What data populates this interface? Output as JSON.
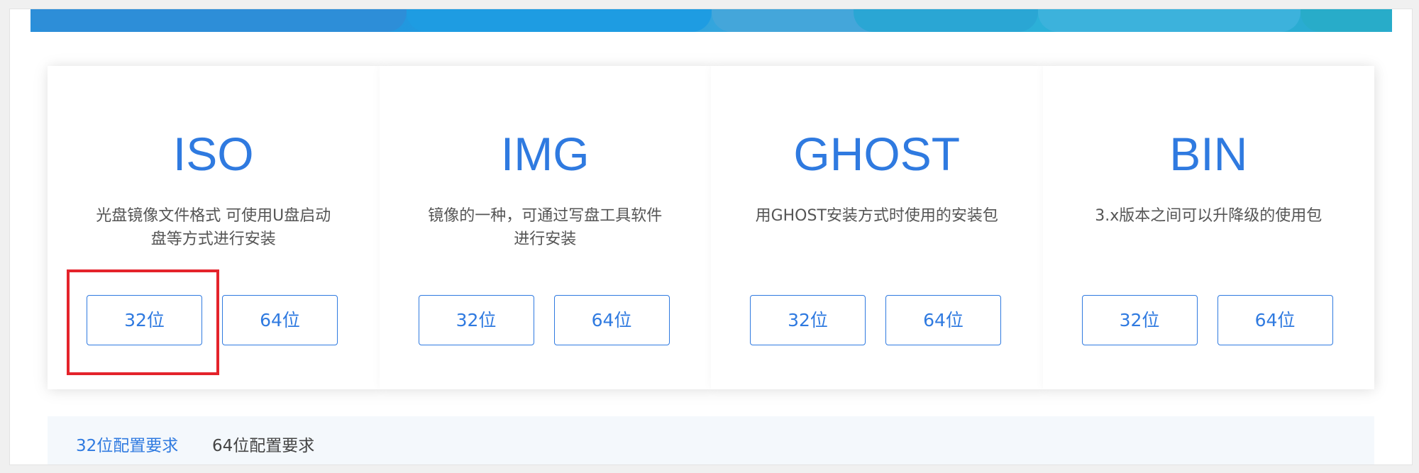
{
  "cards": [
    {
      "title": "ISO",
      "description": "光盘镜像文件格式 可使用U盘启动盘等方式进行安装",
      "button_32": "32位",
      "button_64": "64位"
    },
    {
      "title": "IMG",
      "description": "镜像的一种，可通过写盘工具软件进行安装",
      "button_32": "32位",
      "button_64": "64位"
    },
    {
      "title": "GHOST",
      "description": "用GHOST安装方式时使用的安装包",
      "button_32": "32位",
      "button_64": "64位"
    },
    {
      "title": "BIN",
      "description": "3.x版本之间可以升降级的使用包",
      "button_32": "32位",
      "button_64": "64位"
    }
  ],
  "tabs": {
    "items": [
      {
        "label": "32位配置要求"
      },
      {
        "label": "64位配置要求"
      }
    ],
    "active": "32位配置要求"
  },
  "colors": {
    "accent": "#2f7ae0",
    "highlight_box": "#e4232b",
    "banner": "#1f9be0",
    "tabs_background": "#f4f8fc"
  }
}
